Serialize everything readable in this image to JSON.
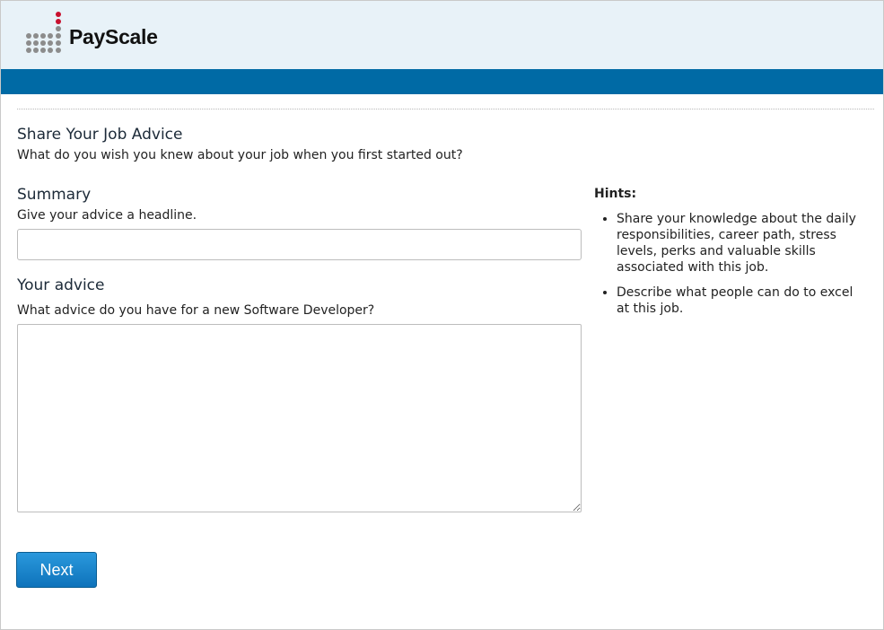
{
  "brand": {
    "name": "PayScale"
  },
  "form": {
    "title": "Share Your Job Advice",
    "subtitle": "What do you wish you knew about your job when you first started out?",
    "summary": {
      "label": "Summary",
      "help": "Give your advice a headline.",
      "value": ""
    },
    "advice": {
      "label": "Your advice",
      "help": "What advice do you have for a new Software Developer?",
      "value": ""
    },
    "next_label": "Next"
  },
  "hints": {
    "title": "Hints:",
    "items": [
      "Share your knowledge about the daily responsibilities, career path, stress levels, perks and valuable skills associated with this job.",
      "Describe what people can do to excel at this job."
    ]
  },
  "colors": {
    "header_bg": "#e8f2f8",
    "brand_bar": "#006aa5",
    "button": "#1a86cf",
    "logo_accent": "#c8102e"
  }
}
